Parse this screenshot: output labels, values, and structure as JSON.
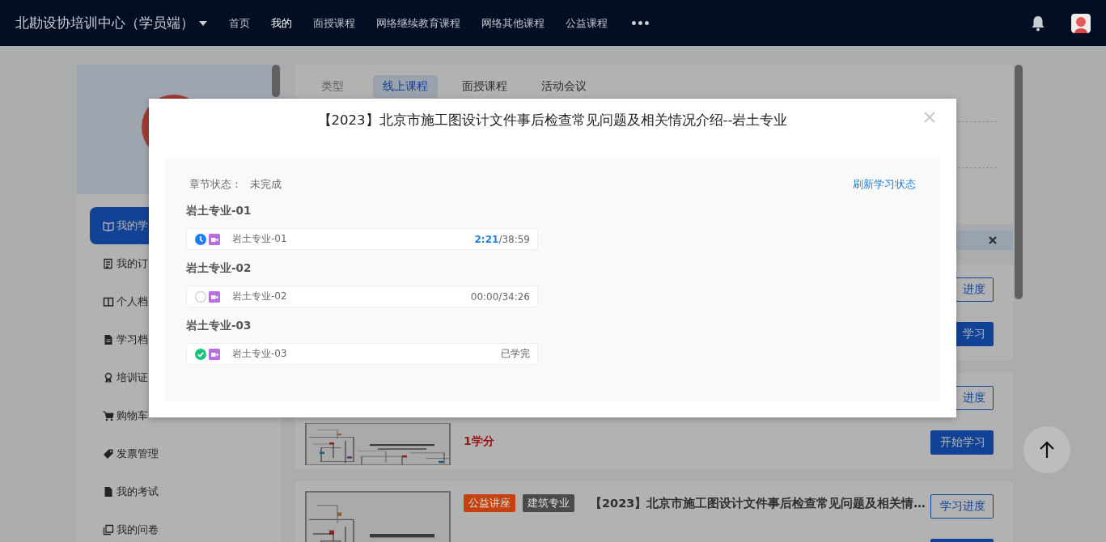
{
  "navbar": {
    "title": "北勘设协培训中心（学员端）",
    "items": [
      {
        "label": "首页",
        "selected": false
      },
      {
        "label": "我的",
        "selected": true
      },
      {
        "label": "面授课程",
        "selected": false
      },
      {
        "label": "网络继续教育课程",
        "selected": false
      },
      {
        "label": "网络其他课程",
        "selected": false
      },
      {
        "label": "公益课程",
        "selected": false
      }
    ],
    "more": "•••"
  },
  "sidebar": {
    "items": [
      {
        "label": "我的学",
        "selected": true
      },
      {
        "label": "我的订",
        "selected": false
      },
      {
        "label": "个人档",
        "selected": false
      },
      {
        "label": "学习档",
        "selected": false
      },
      {
        "label": "培训证",
        "selected": false
      },
      {
        "label": "购物车",
        "selected": false
      },
      {
        "label": "发票管理",
        "selected": false
      },
      {
        "label": "我的考试",
        "selected": false
      },
      {
        "label": "我的问卷",
        "selected": false
      }
    ]
  },
  "filter": {
    "label": "类型",
    "tabs": [
      {
        "label": "线上课程",
        "selected": true
      },
      {
        "label": "面授课程",
        "selected": false
      },
      {
        "label": "活动会议",
        "selected": false
      }
    ]
  },
  "courses": [
    {
      "buttons": [
        {
          "kind": "outline",
          "label": "进度"
        },
        {
          "kind": "primary",
          "label": "学习"
        }
      ]
    },
    {
      "thumbnail": {
        "kind": "picture"
      },
      "credit": "1学分",
      "buttons": [
        {
          "kind": "outline",
          "label": "进度"
        },
        {
          "kind": "primary",
          "label": "开始学习"
        }
      ]
    },
    {
      "thumbnail": {
        "kind": "picture"
      },
      "tags": [
        {
          "label": "公益讲座",
          "color": "#c4420e"
        },
        {
          "label": "建筑专业",
          "color": "#4a4a4a"
        }
      ],
      "title": "【2023】北京市施工图设计文件事后检查常见问题及相关情…",
      "buttons": [
        {
          "kind": "outline",
          "label": "学习进度"
        },
        {
          "kind": "primary"
        }
      ]
    }
  ],
  "modal": {
    "title": "【2023】北京市施工图设计文件事后检查常见问题及相关情况介绍--岩土专业",
    "status_label": "章节状态：",
    "status": "未完成",
    "refresh_link": "刷新学习状态",
    "chapters": [
      {
        "heading": "岩土专业-01",
        "lesson": {
          "title": "岩土专业-01",
          "started": true,
          "completed": false,
          "progress": "**2:21**/38:59"
        }
      },
      {
        "heading": "岩土专业-02",
        "lesson": {
          "title": "岩土专业-02",
          "started": false,
          "completed": false,
          "progress": "00:00/34:26"
        }
      },
      {
        "heading": "岩土专业-03",
        "lesson": {
          "title": "岩土专业-03",
          "completed": true,
          "progress": "已学完"
        }
      }
    ]
  }
}
